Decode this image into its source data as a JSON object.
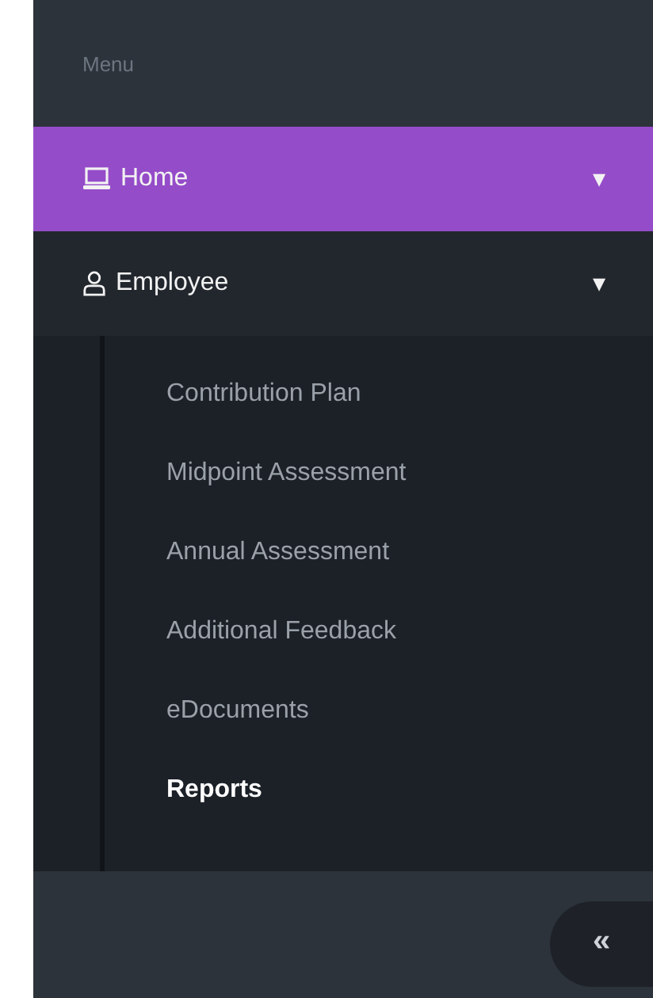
{
  "sidebar": {
    "header": "Menu",
    "items": [
      {
        "label": "Home",
        "selected": true,
        "caret": "▾"
      },
      {
        "label": "Employee",
        "selected": false,
        "caret": "▾",
        "children": [
          {
            "label": "Contribution Plan",
            "selected": false
          },
          {
            "label": "Midpoint Assessment",
            "selected": false
          },
          {
            "label": "Annual Assessment",
            "selected": false
          },
          {
            "label": "Additional Feedback",
            "selected": false
          },
          {
            "label": "eDocuments",
            "selected": false
          },
          {
            "label": "Reports",
            "selected": true
          }
        ]
      }
    ],
    "collapse_button": "«"
  }
}
